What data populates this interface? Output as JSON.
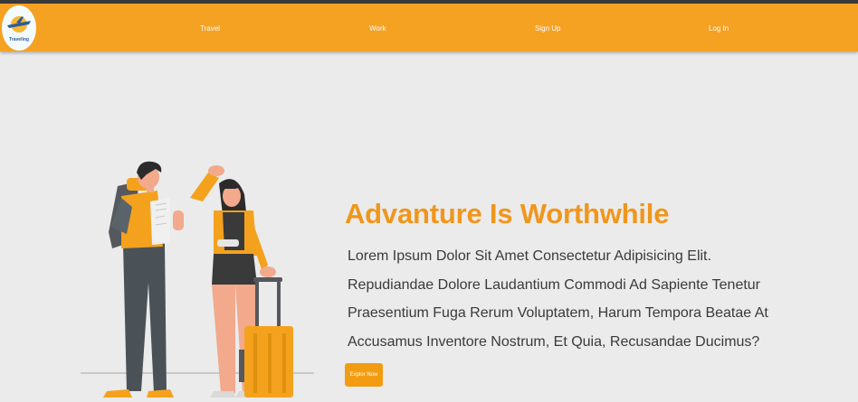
{
  "brand": {
    "logo_text": "Traveling"
  },
  "nav": {
    "travel": "Travel",
    "work": "Work",
    "signup": "Sign Up",
    "login": "Log In"
  },
  "hero": {
    "title": "Advanture Is Worthwhile",
    "text": "Lorem Ipsum Dolor Sit Amet Consectetur Adipisicing Elit. Repudiandae Dolore Laudantium Commodi Ad Sapiente Tenetur Praesentium Fuga Rerum Voluptatem, Harum Tempora Beatae At Accusamus Inventore Nostrum, Et Quia, Recusandae Ducimus?",
    "cta": "Explor Now"
  },
  "colors": {
    "navbar": "#f5a122",
    "accent": "#f0961c",
    "background": "#ebebeb",
    "body_text": "#3a3a3a"
  },
  "icons": [
    "traveling-logo-icon",
    "travelers-illustration"
  ]
}
